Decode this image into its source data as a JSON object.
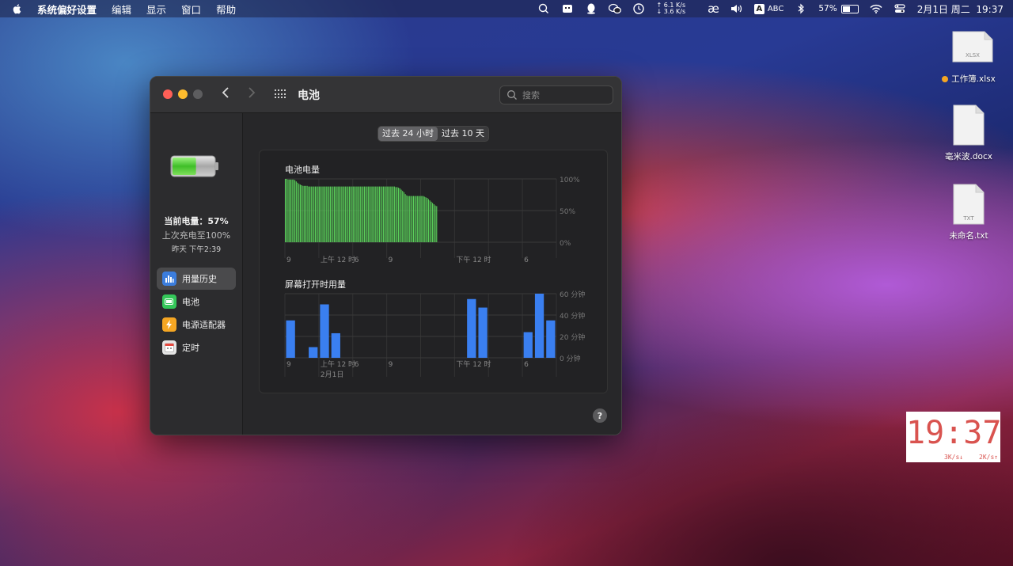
{
  "menubar": {
    "app": "系统偏好设置",
    "menus": [
      "编辑",
      "显示",
      "窗口",
      "帮助"
    ],
    "net_up": "↑ 6.1 K/s",
    "net_down": "↓ 3.6 K/s",
    "ae": "æ",
    "input_badge": "A",
    "input": "ABC",
    "battery": "57%",
    "battery_level": 0.57,
    "datetime": "2月1日 周二  19:37"
  },
  "window": {
    "title": "电池",
    "search_placeholder": "搜索"
  },
  "sidebar": {
    "current_charge": "当前电量：57%",
    "last_charged": "上次充电至100%",
    "last_charged_time": "昨天 下午2:39",
    "items": [
      {
        "label": "用量历史",
        "icon": "usage-history-icon",
        "color": "#3b7ddd"
      },
      {
        "label": "电池",
        "icon": "battery-icon",
        "color": "#34c759"
      },
      {
        "label": "电源适配器",
        "icon": "lightning-icon",
        "color": "#f5a623"
      },
      {
        "label": "定时",
        "icon": "calendar-icon",
        "color": "#e5e5e5"
      }
    ]
  },
  "tabs": [
    "过去 24 小时",
    "过去 10 天"
  ],
  "charts": {
    "battery": {
      "title": "电池电量",
      "yticks": [
        "100%",
        "50%",
        "0%"
      ],
      "xticks": [
        {
          "pos": 0,
          "label": "9"
        },
        {
          "pos": 3,
          "label": "上午 12 时"
        },
        {
          "pos": 6,
          "label": "6"
        },
        {
          "pos": 9,
          "label": "9"
        },
        {
          "pos": 15,
          "label": "下午 12 时"
        },
        {
          "pos": 21,
          "label": "6"
        }
      ]
    },
    "screen": {
      "title": "屏幕打开时用量",
      "yticks": [
        "60 分钟",
        "40 分钟",
        "20 分钟",
        "0 分钟"
      ],
      "date_label": "2月1日"
    }
  },
  "help": "?",
  "desktop": [
    {
      "name": "工作簿.xlsx",
      "type": "XLSX",
      "tagged": true
    },
    {
      "name": "毫米波.docx",
      "type": "",
      "tagged": false
    },
    {
      "name": "未命名.txt",
      "type": "TXT",
      "tagged": false
    }
  ],
  "clock_widget": {
    "time": "19:37",
    "down": "3K/s↓",
    "up": "2K/s↑"
  },
  "chart_data": [
    {
      "type": "bar",
      "title": "电池电量",
      "x_tick_labels": [
        "9",
        "上午 12 时",
        "6",
        "9",
        "下午 12 时",
        "6"
      ],
      "ylim": [
        0,
        100
      ],
      "y_unit": "%",
      "values": [
        100,
        100,
        99,
        99,
        99,
        99,
        99,
        98,
        96,
        94,
        92,
        91,
        90,
        89,
        89,
        89,
        89,
        88,
        88,
        88,
        88,
        88,
        88,
        88,
        88,
        88,
        88,
        88,
        88,
        88,
        88,
        88,
        88,
        88,
        88,
        88,
        88,
        88,
        88,
        88,
        88,
        88,
        88,
        88,
        88,
        88,
        88,
        88,
        88,
        88,
        88,
        88,
        88,
        88,
        88,
        88,
        88,
        88,
        88,
        88,
        88,
        88,
        88,
        88,
        88,
        88,
        88,
        88,
        88,
        88,
        88,
        88,
        88,
        88,
        88,
        88,
        88,
        88,
        88,
        88,
        88,
        87,
        87,
        86,
        85,
        83,
        81,
        79,
        76,
        74,
        73,
        73,
        73,
        73,
        73,
        73,
        73,
        73,
        73,
        73,
        73,
        73,
        72,
        71,
        70,
        68,
        66,
        64,
        62,
        60,
        58,
        57
      ],
      "color": "#5ad05a"
    },
    {
      "type": "bar",
      "title": "屏幕打开时用量",
      "x_tick_labels": [
        "9",
        "上午 12 时",
        "6",
        "9",
        "下午 12 时",
        "6"
      ],
      "date_label": "2月1日",
      "ylim": [
        0,
        60
      ],
      "y_unit": "分钟",
      "values": [
        35,
        0,
        10,
        50,
        23,
        0,
        0,
        0,
        0,
        0,
        0,
        0,
        0,
        0,
        0,
        0,
        55,
        47,
        0,
        0,
        0,
        24,
        60,
        35
      ],
      "color": "#3a7ff0"
    }
  ]
}
